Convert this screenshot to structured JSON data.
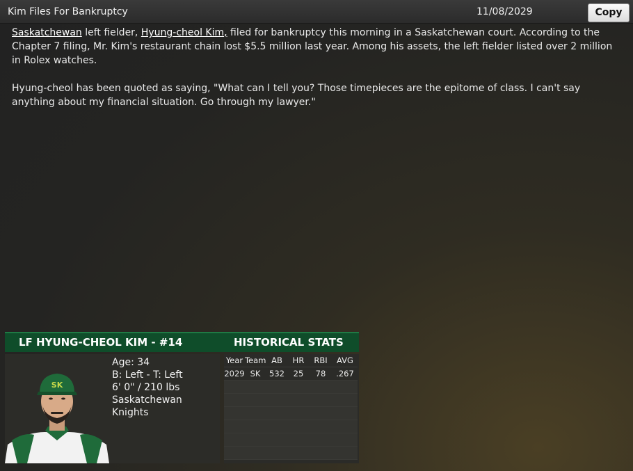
{
  "header": {
    "title": "Kim Files For Bankruptcy",
    "date": "11/08/2029",
    "copy_label": "Copy"
  },
  "article": {
    "p1_link1": "Saskatchewan",
    "p1_text1": " left fielder, ",
    "p1_link2": "Hyung-cheol Kim,",
    "p1_text2": " filed for bankruptcy this morning in a Saskatchewan court. According to the Chapter 7 filing, Mr. Kim's restaurant chain lost $5.5 million last year. Among his assets, the left fielder listed over 2 million in Rolex watches.",
    "p2": "Hyung-cheol has been quoted as saying, \"What can I tell you? Those timepieces are the epitome of class. I can't say anything about my financial situation. Go through my lawyer.\""
  },
  "player": {
    "name_header": "LF HYUNG-CHEOL KIM - #14",
    "age": "Age: 34",
    "bats_throws": "B: Left - T: Left",
    "size": "6' 0\"  / 210 lbs",
    "team": "Saskatchewan Knights",
    "cap_logo": "SK"
  },
  "stats": {
    "header": "HISTORICAL STATS",
    "columns": [
      "Year",
      "Team",
      "AB",
      "HR",
      "RBI",
      "AVG"
    ],
    "rows": [
      [
        "2029",
        "SK",
        "532",
        "25",
        "78",
        ".267"
      ]
    ]
  },
  "colors": {
    "accent_green": "#0f4d2a",
    "cap_green": "#1f6b3a"
  }
}
